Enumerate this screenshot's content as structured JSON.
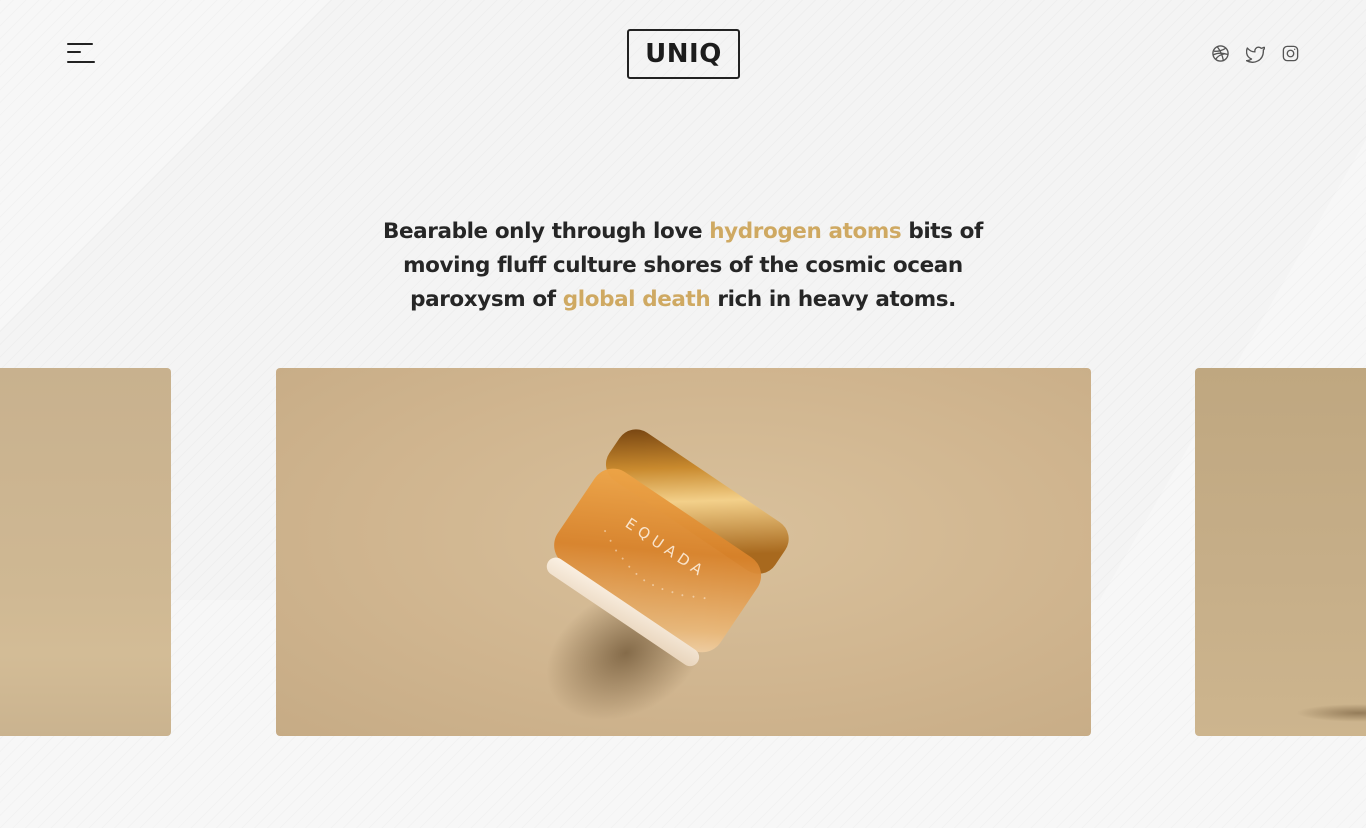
{
  "brand": {
    "logo_text": "UNIQ"
  },
  "header": {
    "menu_icon": "hamburger-menu-icon",
    "socials": [
      {
        "icon": "dribbble-icon"
      },
      {
        "icon": "twitter-icon"
      },
      {
        "icon": "instagram-icon"
      }
    ]
  },
  "hero": {
    "part1": "Bearable only through love ",
    "accent1": "hydrogen atoms",
    "part2": " bits of moving fluff culture shores of the cosmic ocean paroxysm of ",
    "accent2": "global death",
    "part3": " rich in heavy atoms."
  },
  "slider": {
    "product_label": "EQUADA"
  },
  "colors": {
    "accent": "#cfa962",
    "text": "#262626",
    "background": "#f7f7f7"
  }
}
